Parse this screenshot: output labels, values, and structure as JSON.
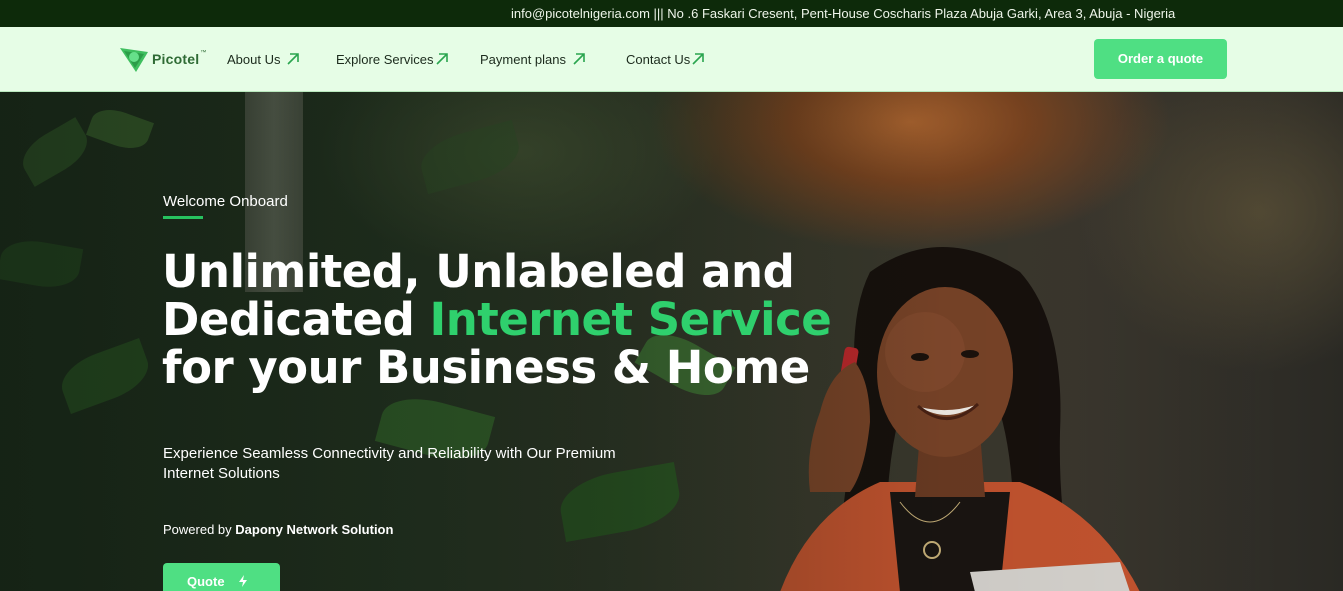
{
  "topbar": {
    "contact_info": "info@picotelnigeria.com ||| No .6 Faskari Cresent, Pent-House Coscharis Plaza Abuja Garki, Area 3, Abuja - Nigeria"
  },
  "brand": {
    "name": "Picotel",
    "trademark": "™",
    "accent_color": "#4fdf83",
    "dark_green": "#0d2a0a"
  },
  "nav": {
    "items": [
      {
        "label": "About Us",
        "icon": "arrow-up-right-icon"
      },
      {
        "label": "Explore Services",
        "icon": "arrow-up-right-icon"
      },
      {
        "label": "Payment plans",
        "icon": "arrow-up-right-icon"
      },
      {
        "label": "Contact Us",
        "icon": "arrow-up-right-icon"
      }
    ],
    "cta_label": "Order a quote"
  },
  "hero": {
    "eyebrow": "Welcome Onboard",
    "headline_line1": "Unlimited, Unlabeled and",
    "headline_line2_part1": "Dedicated ",
    "headline_line2_accent": "Internet Service",
    "headline_line3": "for your Business & Home",
    "subtext": "Experience Seamless Connectivity and Reliability with Our Premium Internet Solutions",
    "powered_prefix": "Powered by ",
    "powered_by": "Dapony Network Solution",
    "cta_label": "Quote",
    "cta_icon": "lightning-icon"
  }
}
